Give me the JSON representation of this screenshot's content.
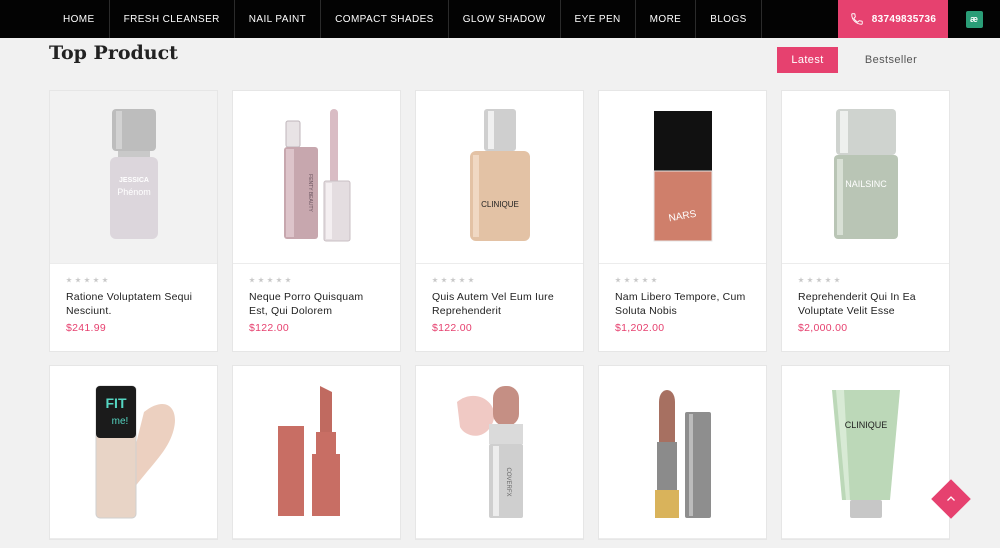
{
  "nav": {
    "items": [
      "HOME",
      "FRESH CLEANSER",
      "NAIL PAINT",
      "COMPACT SHADES",
      "GLOW SHADOW",
      "EYE PEN",
      "MORE",
      "BLOGS"
    ],
    "phone": "83749835736",
    "logo_text": "æ"
  },
  "section": {
    "title": "Top Product",
    "tabs": [
      "Latest",
      "Bestseller"
    ],
    "active_tab": "Latest"
  },
  "products": [
    {
      "name": "Ratione Voluptatem Sequi Nesciunt.",
      "price": "$241.99",
      "image": "nail-polish-jessica",
      "rating": 0
    },
    {
      "name": "Neque Porro Quisquam Est, Qui Dolorem",
      "price": "$122.00",
      "image": "lip-gloss-fenty",
      "rating": 0
    },
    {
      "name": "Quis Autem Vel Eum Iure Reprehenderit",
      "price": "$122.00",
      "image": "foundation-clinique",
      "rating": 0
    },
    {
      "name": "Nam Libero Tempore, Cum Soluta Nobis",
      "price": "$1,202.00",
      "image": "blush-nars",
      "rating": 0
    },
    {
      "name": "Reprehenderit Qui In Ea Voluptate Velit Esse",
      "price": "$2,000.00",
      "image": "nail-polish-nailsinc",
      "rating": 0
    },
    {
      "name": "",
      "price": "",
      "image": "foundation-fitme",
      "rating": 0
    },
    {
      "name": "",
      "price": "",
      "image": "lipstick-3ce",
      "rating": 0
    },
    {
      "name": "",
      "price": "",
      "image": "highlighter-stick",
      "rating": 0
    },
    {
      "name": "",
      "price": "",
      "image": "lipstick-gold",
      "rating": 0
    },
    {
      "name": "",
      "price": "",
      "image": "cleanser-clinique",
      "rating": 0
    }
  ],
  "image_text": {
    "jessica_brand": "JESSICA",
    "jessica_line": "Phénom",
    "clinique": "CLINIQUE",
    "nars": "NARS",
    "nailsinc": "NAILSINC",
    "fitme_top": "FIT",
    "fitme_bottom": "me!",
    "fenty": "FENTY BEAUTY",
    "covfx": "COVERFX"
  },
  "colors": {
    "accent": "#e6416f",
    "nav_bg": "#030303",
    "page_bg": "#f1f1f1"
  }
}
